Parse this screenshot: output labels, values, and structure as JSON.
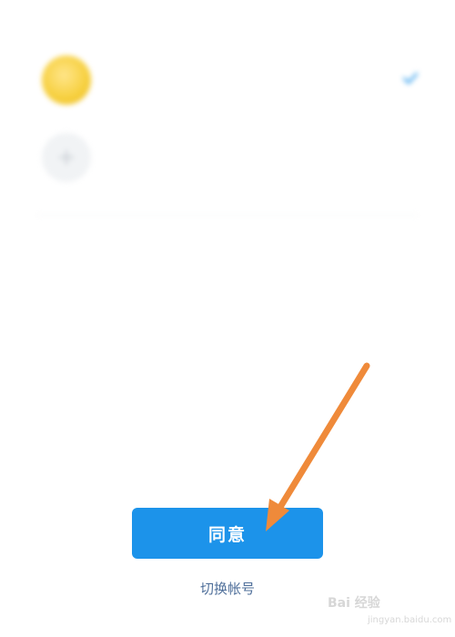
{
  "screen": {
    "prompt_text": "",
    "account": {
      "name": "",
      "subtitle": ""
    },
    "add_account_label": "",
    "agree_button_label": "同意",
    "switch_account_label": "切换帐号"
  },
  "icons": {
    "avatar": "avatar",
    "selected_check": "check-icon",
    "add_account": "plus-icon",
    "annotation": "arrow-icon"
  },
  "colors": {
    "primary_button": "#1c93ea",
    "link": "#4f6f9a",
    "annotation_arrow": "#ef8a3a",
    "check": "#1c93ea"
  },
  "watermark": {
    "brand": "Bai 经验",
    "url": "jingyan.baidu.com"
  }
}
